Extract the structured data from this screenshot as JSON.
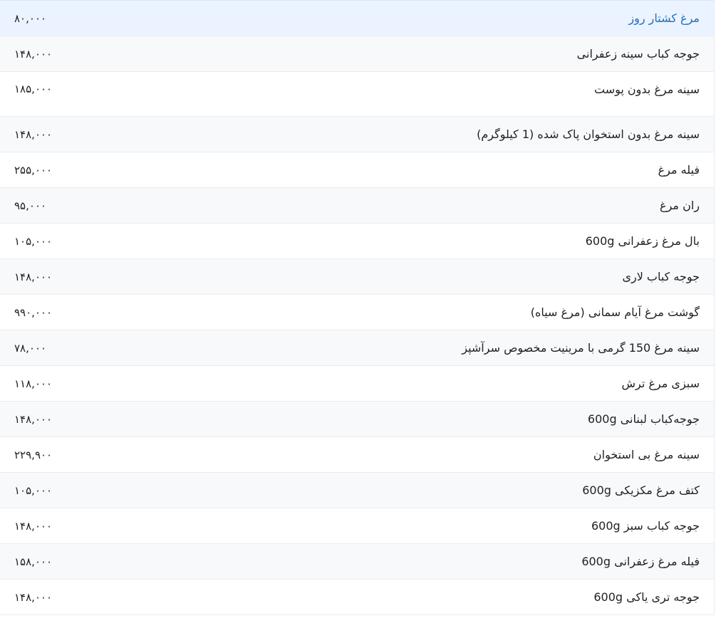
{
  "rows": [
    {
      "name": "مرغ کشتار روز",
      "price": "۸۰,۰۰۰",
      "highlight": true
    },
    {
      "name": "جوجه کباب سینه زعفرانی",
      "price": "۱۴۸,۰۰۰"
    },
    {
      "name": "سینه مرغ بدون پوست",
      "price": "۱۸۵,۰۰۰",
      "tall": true
    },
    {
      "name": "سینه مرغ بدون استخوان پاک شده (1 کیلوگرم)",
      "price": "۱۴۸,۰۰۰"
    },
    {
      "name": "فیله مرغ",
      "price": "۲۵۵,۰۰۰"
    },
    {
      "name": "ران مرغ",
      "price": "۹۵,۰۰۰"
    },
    {
      "name": "بال مرغ زعفرانی 600g",
      "price": "۱۰۵,۰۰۰"
    },
    {
      "name": "جوجه کباب لاری",
      "price": "۱۴۸,۰۰۰"
    },
    {
      "name": "گوشت مرغ آیام سمانی (مرغ سیاه)",
      "price": "۹۹۰,۰۰۰"
    },
    {
      "name": "سینه مرغ 150 گرمی با مرینیت مخصوص سرآشپز",
      "price": "۷۸,۰۰۰"
    },
    {
      "name": "سبزی مرغ ترش",
      "price": "۱۱۸,۰۰۰"
    },
    {
      "name": "جوجه‌کباب لبنانی 600g",
      "price": "۱۴۸,۰۰۰"
    },
    {
      "name": "سینه مرغ بی استخوان",
      "price": "۲۲۹,۹۰۰"
    },
    {
      "name": "کتف مرغ مکزیکی 600g",
      "price": "۱۰۵,۰۰۰"
    },
    {
      "name": "جوجه کباب سبز 600g",
      "price": "۱۴۸,۰۰۰"
    },
    {
      "name": "فیله مرغ زعفرانی 600g",
      "price": "۱۵۸,۰۰۰"
    },
    {
      "name": "جوجه تری یاکی 600g",
      "price": "۱۴۸,۰۰۰"
    }
  ]
}
